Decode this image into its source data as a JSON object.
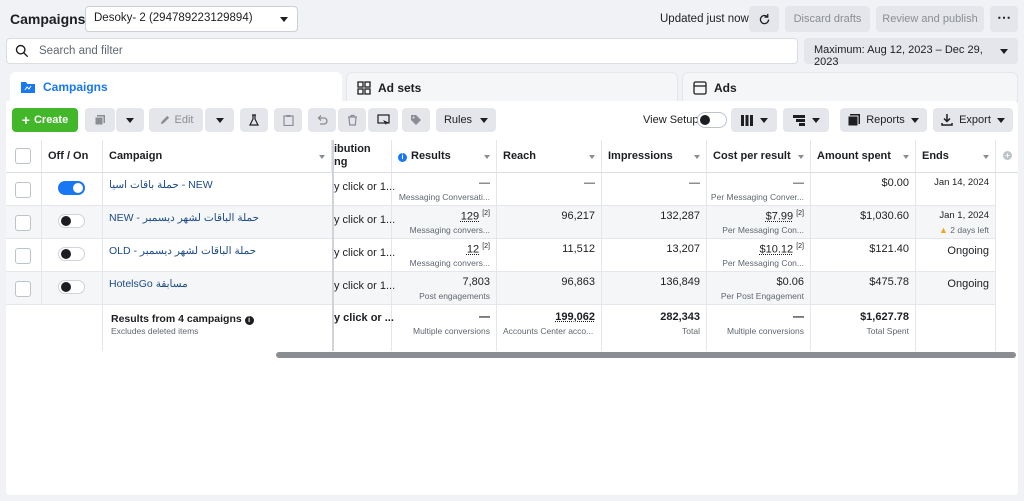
{
  "topbar": {
    "title": "Campaigns",
    "account": "Desoky- 2 (294789223129894)",
    "updated": "Updated just now",
    "discard": "Discard drafts",
    "publish": "Review and publish",
    "more": "⋯"
  },
  "search": {
    "placeholder": "Search and filter"
  },
  "date_range": "Maximum: Aug 12, 2023 – Dec 29, 2023",
  "tabs": [
    {
      "label": "Campaigns",
      "icon": "folder-icon",
      "active": true
    },
    {
      "label": "Ad sets",
      "icon": "grid-icon",
      "active": false
    },
    {
      "label": "Ads",
      "icon": "ad-icon",
      "active": false
    }
  ],
  "toolbar": {
    "create": "Create",
    "edit": "Edit",
    "rules": "Rules",
    "view_setup": "View Setup",
    "reports": "Reports",
    "export": "Export"
  },
  "table": {
    "columns": {
      "offon": "Off / On",
      "campaign": "Campaign",
      "attribution": "ibution\nng",
      "results": "Results",
      "reach": "Reach",
      "impressions": "Impressions",
      "cpr": "Cost per result",
      "spent": "Amount spent",
      "ends": "Ends"
    },
    "rows": [
      {
        "name": "حملة باقات اسيا - NEW",
        "on": true,
        "attribution": "y click or 1...",
        "results": "—",
        "results_sub": "Messaging Conversati...",
        "reach": "—",
        "impressions": "—",
        "cpr": "—",
        "cpr_sub": "Per Messaging Conver...",
        "spent": "$0.00",
        "ends": "Jan 14, 2024",
        "ends_sub": ""
      },
      {
        "name": "NEW - حملة الباقات لشهر ديسمبر",
        "on": false,
        "attribution": "y click or 1...",
        "results": "129",
        "results_sup": "[2]",
        "results_sub": "Messaging convers...",
        "reach": "96,217",
        "impressions": "132,287",
        "cpr": "$7.99",
        "cpr_sup": "[2]",
        "cpr_sub": "Per Messaging Con...",
        "spent": "$1,030.60",
        "ends": "Jan 1, 2024",
        "ends_sub": "2 days left"
      },
      {
        "name": "OLD - حملة الباقات لشهر ديسمبر",
        "on": false,
        "attribution": "y click or 1...",
        "results": "12",
        "results_sup": "[2]",
        "results_sub": "Messaging convers...",
        "reach": "11,512",
        "impressions": "13,207",
        "cpr": "$10.12",
        "cpr_sup": "[2]",
        "cpr_sub": "Per Messaging Con...",
        "spent": "$121.40",
        "ends": "Ongoing",
        "ends_sub": ""
      },
      {
        "name": "HotelsGo مسابقة",
        "on": false,
        "attribution": "y click or 1...",
        "results": "7,803",
        "results_sub": "Post engagements",
        "reach": "96,863",
        "impressions": "136,849",
        "cpr": "$0.06",
        "cpr_sub": "Per Post Engagement",
        "spent": "$475.78",
        "ends": "Ongoing",
        "ends_sub": ""
      }
    ],
    "totals": {
      "label": "Results from 4 campaigns",
      "sub": "Excludes deleted items",
      "attribution": "y click or ...",
      "results": "—",
      "results_sub": "Multiple conversions",
      "reach": "199,062",
      "reach_sub": "Accounts Center acco...",
      "impressions": "282,343",
      "impressions_sub": "Total",
      "cpr": "—",
      "cpr_sub": "Multiple conversions",
      "spent": "$1,627.78",
      "spent_sub": "Total Spent"
    }
  },
  "colors": {
    "accent": "#1877f2",
    "create": "#42b72a"
  }
}
